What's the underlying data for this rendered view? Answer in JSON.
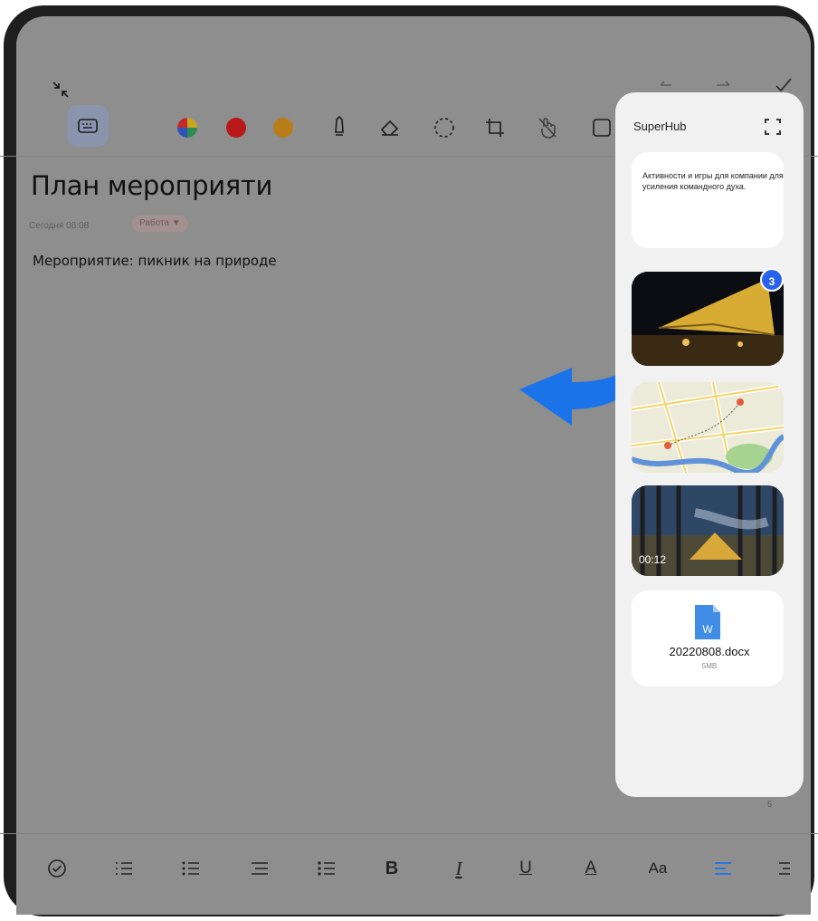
{
  "note": {
    "title": "План мероприяти",
    "date": "Сегодня 08:08",
    "tag": "Работа ▼",
    "body": "Мероприятие: пикник на природе",
    "page_number": "5"
  },
  "superhub": {
    "title": "SuperHub",
    "text_card": "Активности и игры для компании для усиления командного духа.",
    "badge_count": "3",
    "video_duration": "00:12",
    "file": {
      "name": "20220808.docx",
      "size": "5MB",
      "icon_letter": "W"
    }
  },
  "colors": {
    "screen_dim": "#8e8e8e",
    "accent_blue": "#1a73e8",
    "red": "#d81e1e",
    "orange": "#d99a1e",
    "badge": "#2a62f0"
  },
  "icons": {
    "top": [
      "collapse-icon",
      "undo-icon",
      "redo-icon",
      "done-check-icon"
    ],
    "toolbar": [
      "keyboard-icon",
      "color-wheel-icon",
      "red-color-icon",
      "orange-color-icon",
      "pen-icon",
      "eraser-icon",
      "lasso-icon",
      "crop-icon",
      "hand-off-icon",
      "image-icon"
    ],
    "bottom": [
      "checkbox-icon",
      "numbered-list-icon",
      "bullet-list-icon",
      "checklist-icon",
      "indent-list-icon",
      "bold-icon",
      "italic-icon",
      "underline-icon",
      "text-color-icon",
      "font-size-icon",
      "align-left-icon",
      "align-right-icon"
    ]
  },
  "format_bar": {
    "bold": "B",
    "italic": "I",
    "underline": "U",
    "text_color": "A",
    "font_size": "Aa"
  }
}
